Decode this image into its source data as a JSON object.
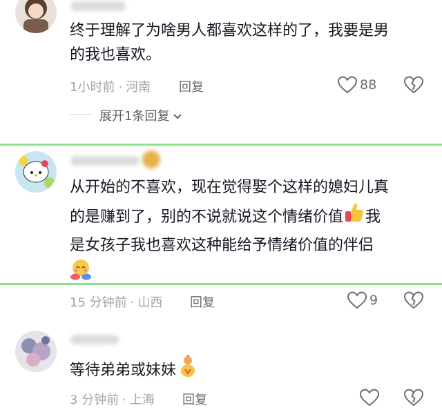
{
  "comments": [
    {
      "text_lines": [
        "终于理解了为啥男人都喜欢这样的了，我要是男",
        "的我也喜欢。"
      ],
      "time": "1小时前",
      "location": "河南",
      "reply_label": "回复",
      "like_count": "88",
      "expand_label": "展开1条回复"
    },
    {
      "text_lines": [
        "从开始的不喜欢，现在觉得娶个这样的媳妇儿真",
        "的是赚到了，别的不说就说这个情绪价值",
        "是女孩子我也喜欢这种能给予情绪价值的伴侣"
      ],
      "line2_tail": "我",
      "time": "15 分钟前",
      "location": "山西",
      "reply_label": "回复",
      "like_count": "9"
    },
    {
      "text_lines": [
        "等待弟弟或妹妹"
      ],
      "time": "3 分钟前",
      "location": "上海",
      "reply_label": "回复",
      "like_count": ""
    }
  ],
  "icons": {
    "like": "heart-outline-icon",
    "dislike": "broken-heart-icon",
    "chevron": "chevron-down-icon"
  },
  "colors": {
    "highlight_border": "#8be28a",
    "meta_text": "#a4a4a8",
    "body_text": "#161823"
  }
}
